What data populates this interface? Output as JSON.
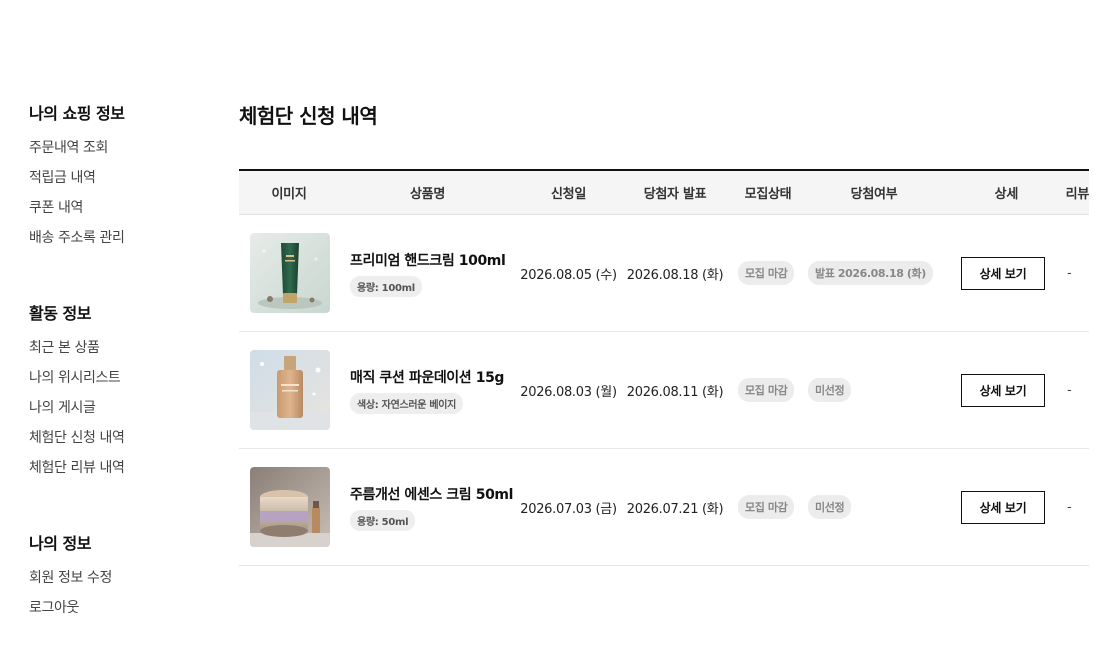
{
  "sidebar": {
    "sections": [
      {
        "title": "나의 쇼핑 정보",
        "items": [
          "주문내역 조회",
          "적립금 내역",
          "쿠폰 내역",
          "배송 주소록 관리"
        ]
      },
      {
        "title": "활동 정보",
        "items": [
          "최근 본 상품",
          "나의 위시리스트",
          "나의 게시글",
          "체험단 신청 내역",
          "체험단 리뷰 내역"
        ]
      },
      {
        "title": "나의 정보",
        "items": [
          "회원 정보 수정",
          "로그아웃"
        ]
      }
    ]
  },
  "main": {
    "title": "체험단 신청 내역",
    "columns": [
      "이미지",
      "상품명",
      "신청일",
      "당첨자 발표",
      "모집상태",
      "당첨여부",
      "상세",
      "리뷰"
    ],
    "rows": [
      {
        "image_icon": "hand-cream-product-image",
        "name": "프리미엄 핸드크림 100ml",
        "option": "용량: 100ml",
        "applied_date": "2026.08.05 (수)",
        "winner_date": "2026.08.18 (화)",
        "status": "모집 마감",
        "result": "발표 2026.08.18 (화)",
        "detail_label": "상세 보기",
        "review": "-"
      },
      {
        "image_icon": "cushion-foundation-product-image",
        "name": "매직 쿠션 파운데이션 15g",
        "option": "색상: 자연스러운 베이지",
        "applied_date": "2026.08.03 (월)",
        "winner_date": "2026.08.11 (화)",
        "status": "모집 마감",
        "result": "미선정",
        "detail_label": "상세 보기",
        "review": "-"
      },
      {
        "image_icon": "essence-cream-product-image",
        "name": "주름개선 에센스 크림 50ml",
        "option": "용량: 50ml",
        "applied_date": "2026.07.03 (금)",
        "winner_date": "2026.07.21 (화)",
        "status": "모집 마감",
        "result": "미선정",
        "detail_label": "상세 보기",
        "review": "-"
      }
    ]
  }
}
